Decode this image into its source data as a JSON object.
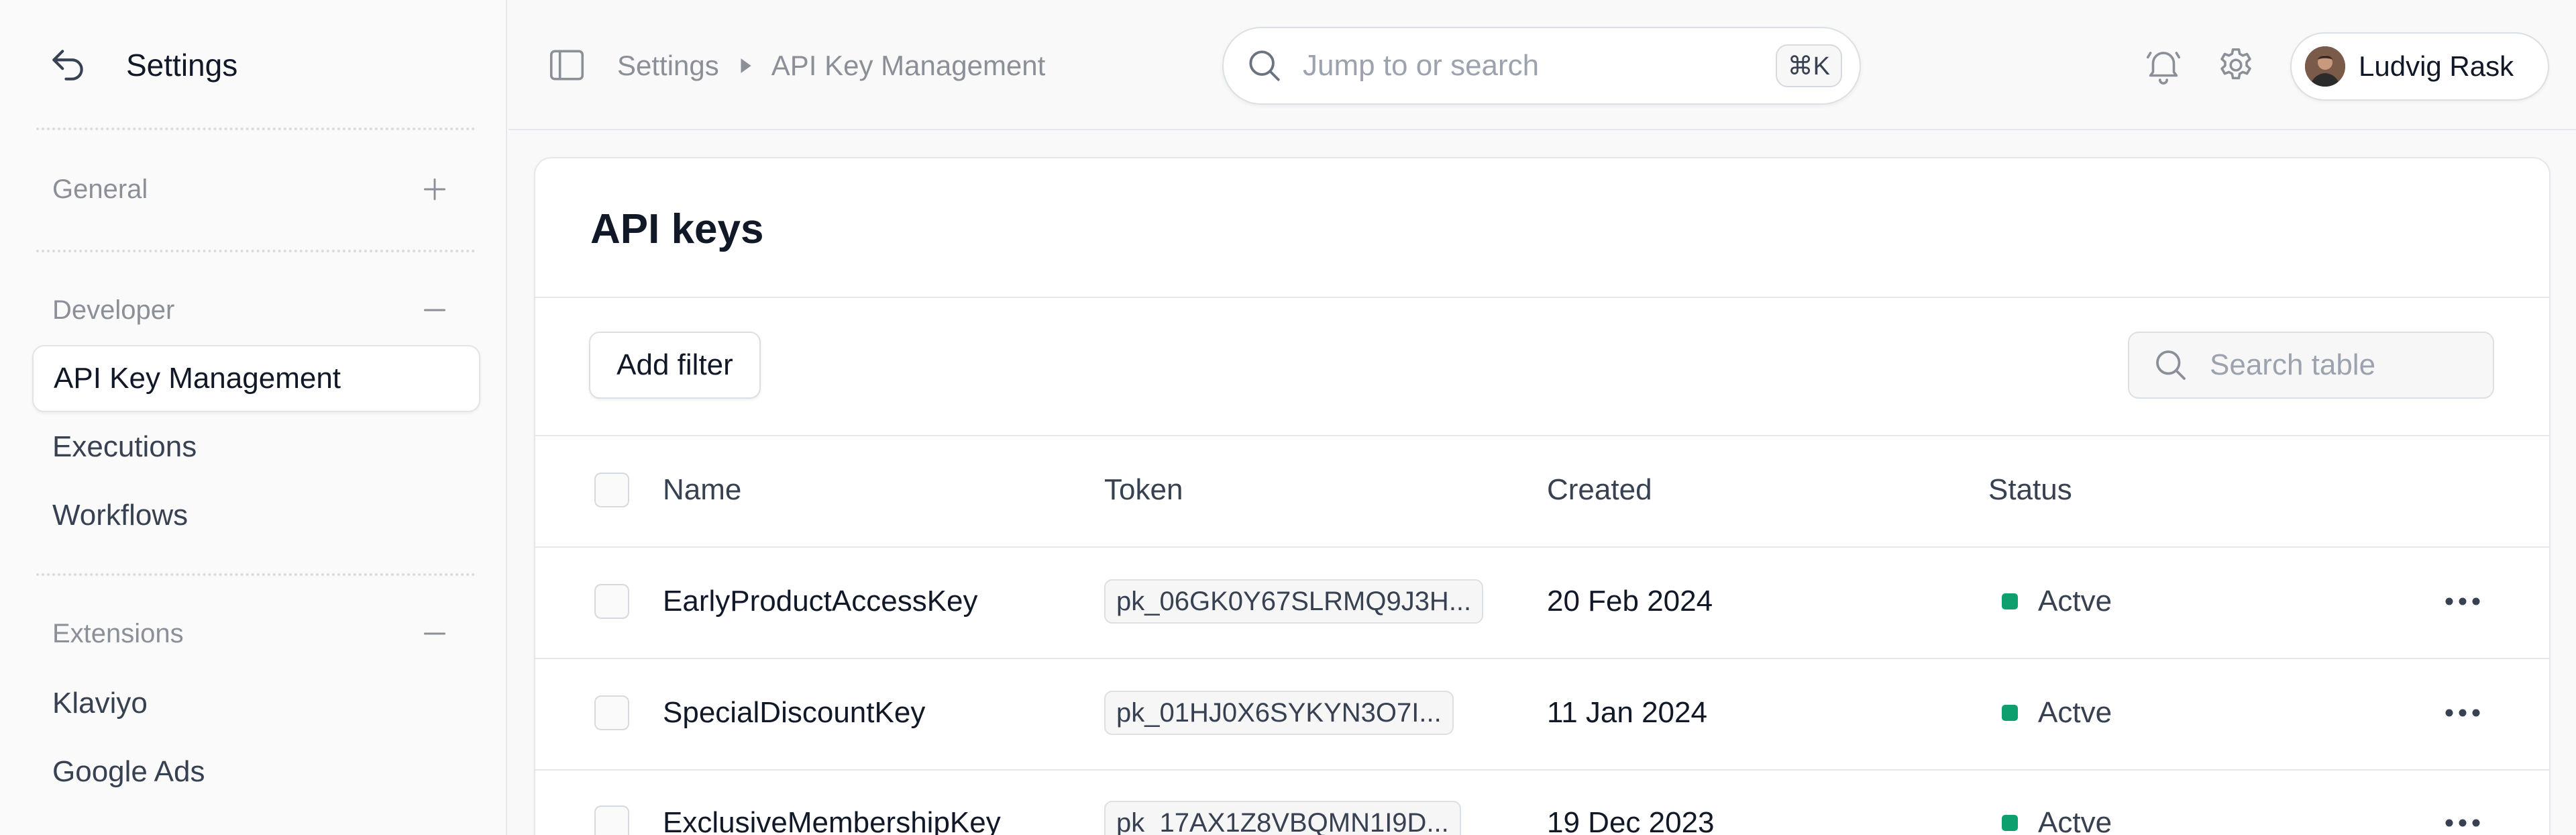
{
  "sidebar": {
    "title": "Settings",
    "sections": [
      {
        "label": "General",
        "toggle": "+"
      },
      {
        "label": "Developer",
        "toggle": "−"
      },
      {
        "label": "Extensions",
        "toggle": "−"
      }
    ],
    "items": {
      "api_key_management": "API Key Management",
      "executions": "Executions",
      "workflows": "Workflows",
      "klaviyo": "Klaviyo",
      "google_ads": "Google Ads"
    }
  },
  "topbar": {
    "breadcrumb": [
      "Settings",
      "API Key Management"
    ],
    "search": {
      "placeholder": "Jump to or search",
      "shortcut": "⌘K"
    },
    "user": {
      "name": "Ludvig Rask"
    }
  },
  "card": {
    "title": "API keys",
    "add_filter": "Add filter",
    "search_placeholder": "Search table",
    "columns": [
      "Name",
      "Token",
      "Created",
      "Status"
    ],
    "rows": [
      {
        "name": "EarlyProductAccessKey",
        "token": "pk_06GK0Y67SLRMQ9J3H...",
        "created": "20 Feb 2024",
        "status": "Actve"
      },
      {
        "name": "SpecialDiscountKey",
        "token": "pk_01HJ0X6SYKYN3O7I...",
        "created": "11 Jan 2024",
        "status": "Actve"
      },
      {
        "name": "ExclusiveMembershipKey",
        "token": "pk_17AX1Z8VBQMN1I9D...",
        "created": "19 Dec 2023",
        "status": "Actve"
      }
    ]
  },
  "colors": {
    "status_active": "#0e9f6e",
    "muted_text": "#8b8f98",
    "border": "#e5e7eb"
  },
  "icons": [
    "back-arrow-icon",
    "sidebar-toggle-icon",
    "chevron-right-icon",
    "search-icon",
    "bell-icon",
    "gear-icon",
    "more-horizontal-icon",
    "plus-icon",
    "minus-icon"
  ]
}
